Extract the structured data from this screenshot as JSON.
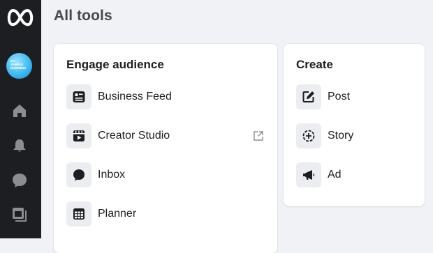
{
  "sidebar": {
    "logo_icon": "meta-logo-icon",
    "account": {
      "avatar_text": "MY\nSAMPLE\nBUSINESS"
    },
    "nav": [
      {
        "icon": "home-icon"
      },
      {
        "icon": "bell-icon"
      },
      {
        "icon": "chat-bubble-icon"
      },
      {
        "icon": "pages-icon"
      }
    ]
  },
  "page": {
    "title": "All tools"
  },
  "engage": {
    "title": "Engage audience",
    "items": [
      {
        "label": "Business Feed",
        "icon": "feed-icon"
      },
      {
        "label": "Creator Studio",
        "icon": "clapperboard-icon",
        "external": true
      },
      {
        "label": "Inbox",
        "icon": "chat-bubble-icon"
      },
      {
        "label": "Planner",
        "icon": "calendar-icon"
      }
    ]
  },
  "create": {
    "title": "Create",
    "items": [
      {
        "label": "Post",
        "icon": "edit-icon"
      },
      {
        "label": "Story",
        "icon": "story-add-icon"
      },
      {
        "label": "Ad",
        "icon": "megaphone-icon"
      }
    ]
  },
  "colors": {
    "sidebar_bg": "#1c1e21",
    "page_bg": "#f0f2f5",
    "icon_box_bg": "#ebedf0",
    "nav_icon": "#8a8d91"
  }
}
